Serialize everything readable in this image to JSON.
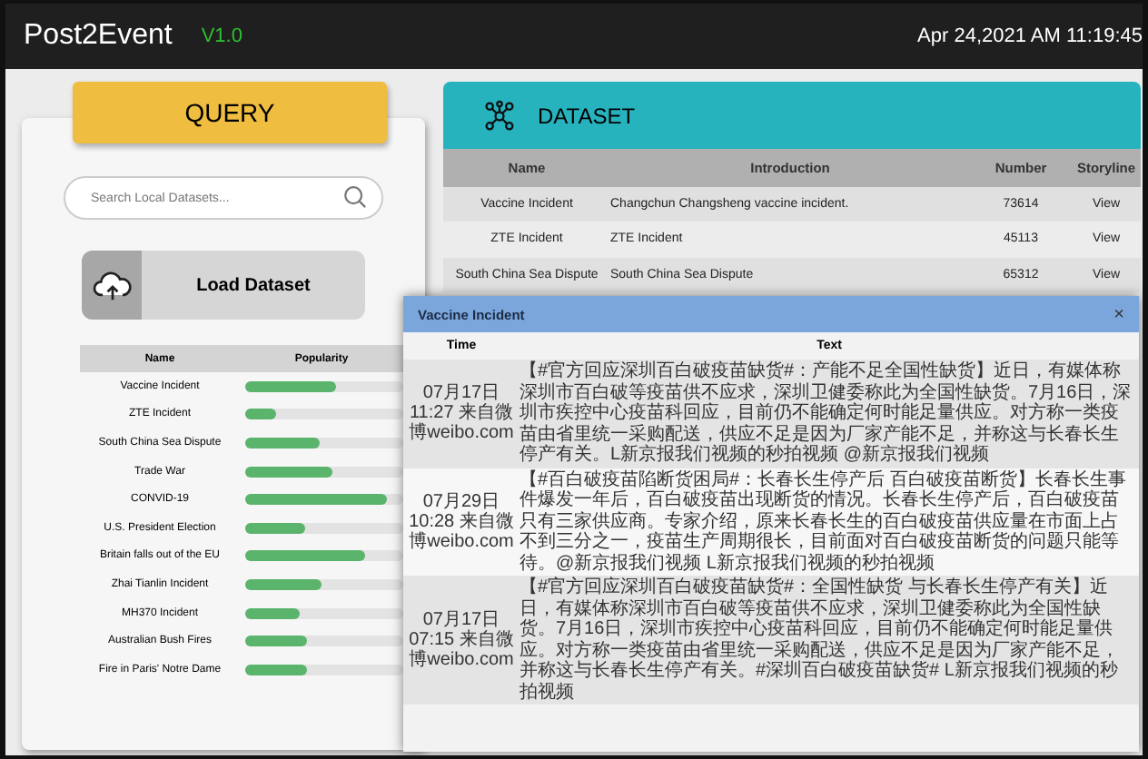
{
  "header": {
    "title": "Post2Event",
    "version": "V1.0",
    "datetime": "Apr 24,2021 AM 11:19:45"
  },
  "query": {
    "tab": "QUERY",
    "search": {
      "placeholder": "Search Local Datasets..."
    },
    "load_button": "Load Dataset",
    "popularity": {
      "columns": [
        "Name",
        "Popularity"
      ],
      "rows": [
        {
          "name": "Vaccine Incident",
          "level": 0.58
        },
        {
          "name": "ZTE Incident",
          "level": 0.2
        },
        {
          "name": "South China Sea Dispute",
          "level": 0.47
        },
        {
          "name": "Trade War",
          "level": 0.55
        },
        {
          "name": "CONVID-19",
          "level": 0.9
        },
        {
          "name": "U.S. President Election",
          "level": 0.38
        },
        {
          "name": "Britain falls out of the EU",
          "level": 0.76
        },
        {
          "name": "Zhai Tianlin Incident",
          "level": 0.48
        },
        {
          "name": "MH370 Incident",
          "level": 0.34
        },
        {
          "name": "Australian Bush Fires",
          "level": 0.39
        },
        {
          "name": "Fire in Paris' Notre Dame",
          "level": 0.39
        }
      ]
    }
  },
  "dataset": {
    "title": "DATASET",
    "columns": [
      "Name",
      "Introduction",
      "Number",
      "Storyline"
    ],
    "rows": [
      {
        "name": "Vaccine Incident",
        "introduction": "Changchun Changsheng vaccine incident.",
        "number": "73614",
        "storyline": "View"
      },
      {
        "name": "ZTE Incident",
        "introduction": "ZTE Incident",
        "number": "45113",
        "storyline": "View"
      },
      {
        "name": "South China Sea Dispute",
        "introduction": "South China Sea Dispute",
        "number": "65312",
        "storyline": "View"
      }
    ]
  },
  "dialog": {
    "title": "Vaccine Incident",
    "close": "×",
    "columns": [
      "Time",
      "Text"
    ],
    "rows": [
      {
        "time": "07月17日11:27 来自微博weibo.com",
        "text": "【#官方回应深圳百白破疫苗缺货#：产能不足全国性缺货】近日，有媒体称深圳市百白破等疫苗供不应求，深圳卫健委称此为全国性缺货。7月16日，深圳市疾控中心疫苗科回应，目前仍不能确定何时能足量供应。对方称一类疫苗由省里统一采购配送，供应不足是因为厂家产能不足，并称这与长春长生停产有关。L新京报我们视频的秒拍视频 @新京报我们视频"
      },
      {
        "time": "07月29日10:28 来自微博weibo.com",
        "text": "【#百白破疫苗陷断货困局#：长春长生停产后 百白破疫苗断货】长春长生事件爆发一年后，百白破疫苗出现断货的情况。长春长生停产后，百白破疫苗只有三家供应商。专家介绍，原来长春长生的百白破疫苗供应量在市面上占不到三分之一，疫苗生产周期很长，目前面对百白破疫苗断货的问题只能等待。@新京报我们视频 L新京报我们视频的秒拍视频"
      },
      {
        "time": "07月17日07:15 来自微博weibo.com",
        "text": "【#官方回应深圳百白破疫苗缺货#：全国性缺货 与长春长生停产有关】近日，有媒体称深圳市百白破等疫苗供不应求，深圳卫健委称此为全国性缺货。7月16日，深圳市疾控中心疫苗科回应，目前仍不能确定何时能足量供应。对方称一类疫苗由省里统一采购配送，供应不足是因为厂家产能不足，并称这与长春长生停产有关。#深圳百白破疫苗缺货# L新京报我们视频的秒拍视频"
      }
    ]
  }
}
